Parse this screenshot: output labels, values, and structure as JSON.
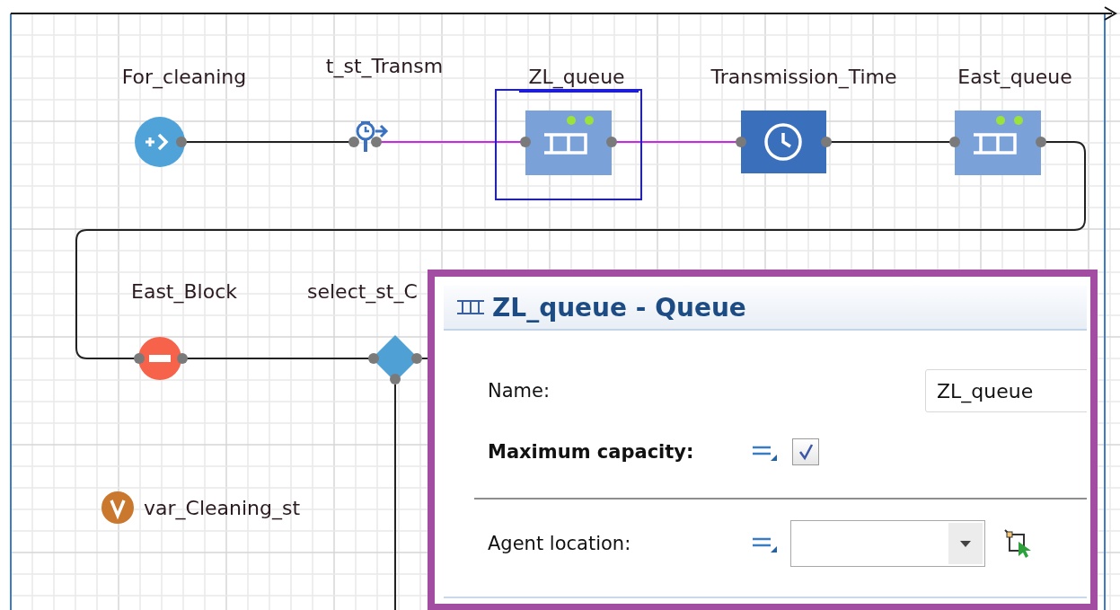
{
  "diagram": {
    "nodes": [
      {
        "kind": "source",
        "label": "For_cleaning",
        "selected": false
      },
      {
        "kind": "time_start",
        "label": "t_st_Transm",
        "selected": false
      },
      {
        "kind": "queue",
        "label": "ZL_queue",
        "selected": true
      },
      {
        "kind": "delay",
        "label": "Transmission_Time",
        "selected": false
      },
      {
        "kind": "queue",
        "label": "East_queue",
        "selected": false
      },
      {
        "kind": "hold",
        "label": "East_Block",
        "selected": false
      },
      {
        "kind": "select",
        "label": "select_st_C",
        "selected": false
      }
    ],
    "connectors": [
      {
        "highlighted": false
      },
      {
        "highlighted": true
      },
      {
        "highlighted": true
      },
      {
        "highlighted": false
      },
      {
        "highlighted": false
      },
      {
        "highlighted": false
      },
      {
        "highlighted": false
      },
      {
        "highlighted": false
      }
    ],
    "variables": [
      {
        "label": "var_Cleaning_st"
      }
    ]
  },
  "properties_panel": {
    "title": "ZL_queue - Queue",
    "fields": [
      {
        "kind": "text",
        "label": "Name:",
        "value": "ZL_queue"
      },
      {
        "kind": "checkbox",
        "label": "Maximum capacity:",
        "checked": true
      },
      {
        "kind": "dropdown",
        "label": "Agent location:"
      }
    ]
  }
}
